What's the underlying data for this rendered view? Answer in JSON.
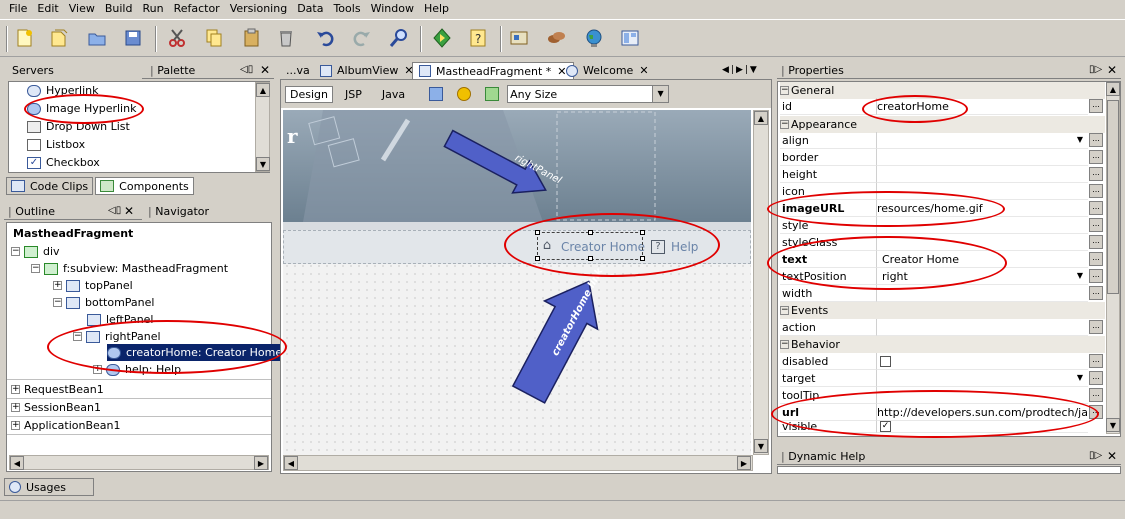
{
  "menu": [
    "File",
    "Edit",
    "View",
    "Build",
    "Run",
    "Refactor",
    "Versioning",
    "Data",
    "Tools",
    "Window",
    "Help"
  ],
  "toolbar_icons": [
    "new-file-icon",
    "new-project-icon",
    "open-project-icon",
    "save-all-icon",
    "cut-icon",
    "copy-icon",
    "paste-icon",
    "delete-icon",
    "undo-icon",
    "redo-icon",
    "find-icon",
    "run-icon",
    "help-icon",
    "deploy-icon",
    "beans-icon",
    "web-icon",
    "layout-icon"
  ],
  "left_top": {
    "tab_servers": "Servers",
    "tab_palette": "Palette",
    "items": [
      "Hyperlink",
      "Image Hyperlink",
      "Drop Down List",
      "Listbox",
      "Checkbox"
    ],
    "bottom_tabs": [
      "Code Clips",
      "Components"
    ]
  },
  "outline": {
    "tab_outline": "Outline",
    "tab_navigator": "Navigator",
    "title": "MastheadFragment",
    "nodes": [
      "div",
      "f:subview: MastheadFragment",
      "topPanel",
      "bottomPanel",
      "leftPanel",
      "rightPanel",
      "creatorHome:   Creator Home",
      "help:    Help",
      "RequestBean1",
      "SessionBean1",
      "ApplicationBean1"
    ]
  },
  "editor": {
    "tabs": [
      "...va",
      "AlbumView",
      "MastheadFragment *",
      "Welcome"
    ],
    "modes": [
      "Design",
      "JSP",
      "Java"
    ],
    "size_select": "Any Size",
    "canvas_link": "Creator Home",
    "canvas_help": "Help",
    "annot_right": "rightPanel",
    "annot_link": "creatorHome link",
    "canvas_letter": "r"
  },
  "properties": {
    "title": "Properties",
    "cats": {
      "general": "General",
      "appearance": "Appearance",
      "events": "Events",
      "behavior": "Behavior"
    },
    "rows": {
      "id": {
        "label": "id",
        "value": "creatorHome"
      },
      "align": {
        "label": "align",
        "value": ""
      },
      "border": {
        "label": "border",
        "value": ""
      },
      "height": {
        "label": "height",
        "value": ""
      },
      "icon": {
        "label": "icon",
        "value": ""
      },
      "imageURL": {
        "label": "imageURL",
        "value": "resources/home.gif"
      },
      "style": {
        "label": "style",
        "value": ""
      },
      "styleClass": {
        "label": "styleClass",
        "value": ""
      },
      "text": {
        "label": "text",
        "value": "Creator Home"
      },
      "textPosition": {
        "label": "textPosition",
        "value": "right"
      },
      "width": {
        "label": "width",
        "value": ""
      },
      "action": {
        "label": "action",
        "value": ""
      },
      "disabled": {
        "label": "disabled",
        "value": ""
      },
      "target": {
        "label": "target",
        "value": ""
      },
      "toolTip": {
        "label": "toolTip",
        "value": ""
      },
      "url": {
        "label": "url",
        "value": "http://developers.sun.com/prodtech/jav..."
      },
      "visible": {
        "label": "visible",
        "value": ""
      }
    },
    "dynamic_help": "Dynamic Help"
  },
  "status": {
    "usages": "Usages"
  }
}
